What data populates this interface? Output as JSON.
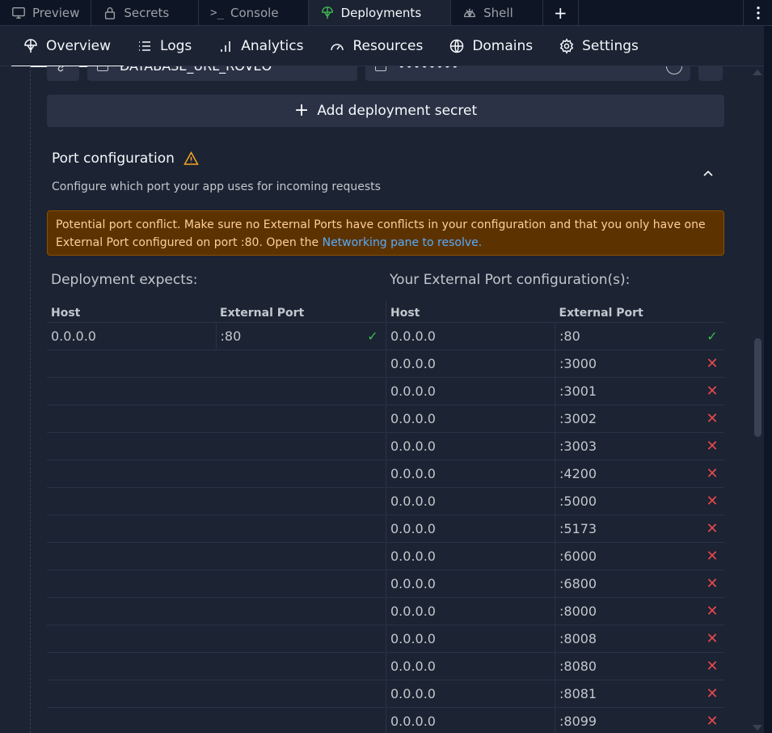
{
  "tabs": [
    {
      "label": "Preview",
      "icon": "monitor-icon"
    },
    {
      "label": "Secrets",
      "icon": "lock-icon"
    },
    {
      "label": "Console",
      "icon": "terminal-icon"
    },
    {
      "label": "Deployments",
      "icon": "deployments-icon",
      "active": true
    },
    {
      "label": "Shell",
      "icon": "shell-icon"
    }
  ],
  "tab_add": "+",
  "subnav": [
    {
      "label": "Overview",
      "icon": "deployments-icon",
      "active": true
    },
    {
      "label": "Logs",
      "icon": "list-icon"
    },
    {
      "label": "Analytics",
      "icon": "bar-chart-icon"
    },
    {
      "label": "Resources",
      "icon": "gauge-icon"
    },
    {
      "label": "Domains",
      "icon": "globe-icon"
    },
    {
      "label": "Settings",
      "icon": "gear-icon"
    }
  ],
  "secret_row": {
    "key": "DATABASE_URL_ROVEO",
    "value": "••••••••"
  },
  "add_secret_label": "Add deployment secret",
  "port_section": {
    "title": "Port configuration",
    "description": "Configure which port your app uses for incoming requests",
    "warning_text": "Potential port conflict. Make sure no External Ports have conflicts in your configuration and that you only have one External Port configured on port :80. Open the ",
    "warning_link": "Networking pane to resolve."
  },
  "deployment_expects": {
    "title": "Deployment expects:",
    "headers": [
      "Host",
      "External Port"
    ],
    "rows": [
      {
        "host": "0.0.0.0",
        "port": ":80",
        "status": "ok"
      }
    ]
  },
  "external_ports": {
    "title": "Your External Port configuration(s):",
    "headers": [
      "Host",
      "External Port"
    ],
    "rows": [
      {
        "host": "0.0.0.0",
        "port": ":80",
        "status": "ok"
      },
      {
        "host": "0.0.0.0",
        "port": ":3000",
        "status": "bad"
      },
      {
        "host": "0.0.0.0",
        "port": ":3001",
        "status": "bad"
      },
      {
        "host": "0.0.0.0",
        "port": ":3002",
        "status": "bad"
      },
      {
        "host": "0.0.0.0",
        "port": ":3003",
        "status": "bad"
      },
      {
        "host": "0.0.0.0",
        "port": ":4200",
        "status": "bad"
      },
      {
        "host": "0.0.0.0",
        "port": ":5000",
        "status": "bad"
      },
      {
        "host": "0.0.0.0",
        "port": ":5173",
        "status": "bad"
      },
      {
        "host": "0.0.0.0",
        "port": ":6000",
        "status": "bad"
      },
      {
        "host": "0.0.0.0",
        "port": ":6800",
        "status": "bad"
      },
      {
        "host": "0.0.0.0",
        "port": ":8000",
        "status": "bad"
      },
      {
        "host": "0.0.0.0",
        "port": ":8008",
        "status": "bad"
      },
      {
        "host": "0.0.0.0",
        "port": ":8080",
        "status": "bad"
      },
      {
        "host": "0.0.0.0",
        "port": ":8081",
        "status": "bad"
      },
      {
        "host": "0.0.0.0",
        "port": ":8099",
        "status": "bad"
      }
    ]
  },
  "colors": {
    "ok": "#3fb950",
    "bad": "#e5484d",
    "warning_bg": "#5c3300",
    "link": "#57abff"
  }
}
